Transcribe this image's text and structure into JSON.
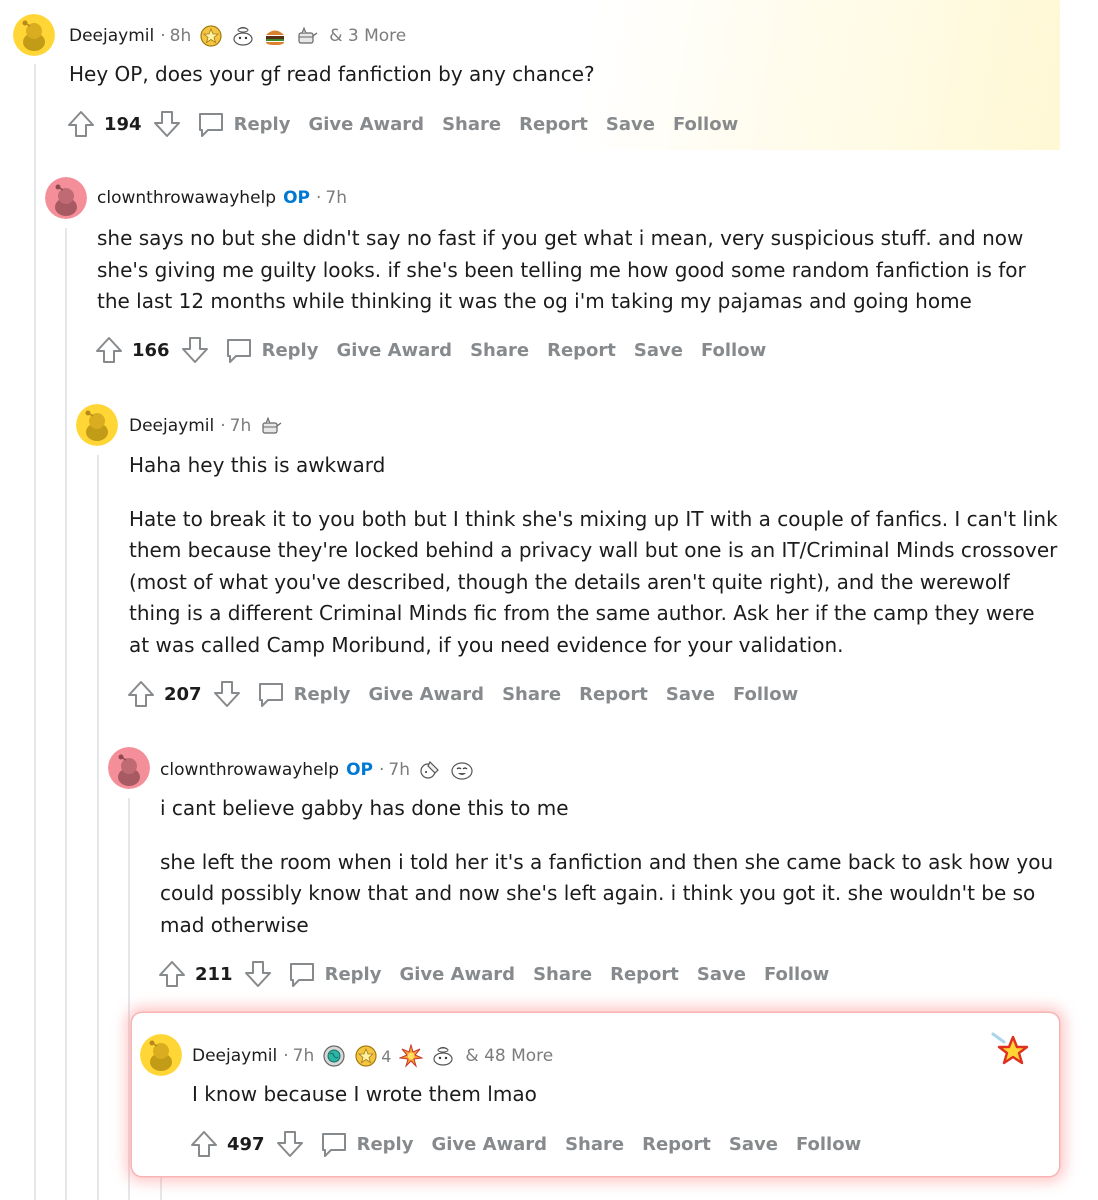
{
  "comments": [
    {
      "author": "Deejaymil",
      "op_badge": "",
      "time": "8h",
      "awards": [
        "gold-award-icon",
        "wholesome-award-icon",
        "burger-award-icon",
        "cake-award-icon"
      ],
      "award_count_label": "",
      "more_awards": "& 3 More",
      "paragraphs": [
        "Hey OP, does your gf read fanfiction by any chance?"
      ],
      "score": "194"
    },
    {
      "author": "clownthrowawayhelp",
      "op_badge": "OP",
      "time": "7h",
      "awards": [],
      "more_awards": "",
      "paragraphs": [
        "she says no but she didn't say no fast if you get what i mean, very suspicious stuff. and now she's giving me guilty looks. if she's been telling me how good some random fanfiction is for the last 12 months while thinking it was the og i'm taking my pajamas and going home"
      ],
      "score": "166"
    },
    {
      "author": "Deejaymil",
      "op_badge": "",
      "time": "7h",
      "awards": [
        "cake-award-icon"
      ],
      "more_awards": "",
      "paragraphs": [
        "Haha hey this is awkward",
        "Hate to break it to you both but I think she's mixing up IT with a couple of fanfics. I can't link them because they're locked behind a privacy wall but one is an IT/Criminal Minds crossover (most of what you've described, though the details aren't quite right), and the werewolf thing is a different Criminal Minds fic from the same author. Ask her if the camp they were at was called Camp Moribund, if you need evidence for your validation."
      ],
      "score": "207"
    },
    {
      "author": "clownthrowawayhelp",
      "op_badge": "OP",
      "time": "7h",
      "awards": [
        "facepalm-award-icon",
        "laughing-face-award-icon"
      ],
      "more_awards": "",
      "paragraphs": [
        "i cant believe gabby has done this to me",
        "she left the room when i told her it's a fanfiction and then she came back to ask how you could possibly know that and now she's left again. i think you got it. she wouldn't be so mad otherwise"
      ],
      "score": "211"
    },
    {
      "author": "Deejaymil",
      "op_badge": "",
      "time": "7h",
      "awards": [
        "globe-award-icon",
        "gold-award-icon",
        "explosion-award-icon",
        "wholesome-award-icon"
      ],
      "award_count_label": "4",
      "more_awards": "& 48 More",
      "paragraphs": [
        "I know because I wrote them lmao"
      ],
      "score": "497"
    }
  ],
  "actions": {
    "reply": "Reply",
    "give_award": "Give Award",
    "share": "Share",
    "report": "Report",
    "save": "Save",
    "follow": "Follow"
  },
  "colors": {
    "op_blue": "#0079d3",
    "action_gray": "#878a8c",
    "avatar_yellow": "#ffd635",
    "avatar_pink": "#f48f9a",
    "highlight_glow": "#ff8a8a"
  }
}
